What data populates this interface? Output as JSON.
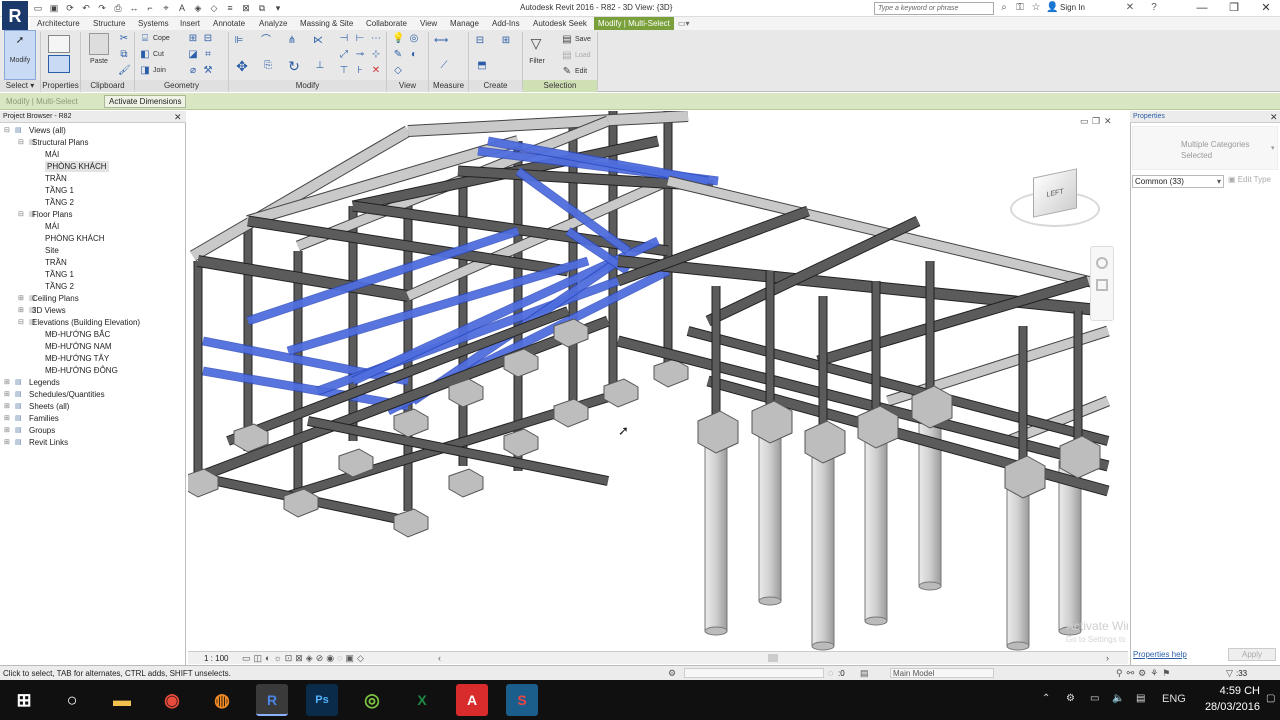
{
  "app": {
    "logo": "R",
    "title": "Autodesk Revit 2016 -    R82 - 3D View: {3D}",
    "search_placeholder": "Type a keyword or phrase",
    "sign_in": "Sign In"
  },
  "tabs": [
    "Architecture",
    "Structure",
    "Systems",
    "Insert",
    "Annotate",
    "Analyze",
    "Massing & Site",
    "Collaborate",
    "View",
    "Manage",
    "Add-Ins",
    "Autodesk Seek",
    "Modify | Multi-Select"
  ],
  "ribbon": {
    "modify": "Modify",
    "paste": "Paste",
    "cope": "Cope",
    "cut": "Cut",
    "join": "Join",
    "filter": "Filter",
    "save": "Save",
    "load": "Load",
    "edit": "Edit",
    "panels": [
      "Select",
      "Properties",
      "Clipboard",
      "Geometry",
      "Modify",
      "View",
      "Measure",
      "Create",
      "Selection"
    ]
  },
  "options_bar": {
    "context": "Modify | Multi-Select",
    "activate": "Activate Dimensions"
  },
  "project_browser": {
    "title": "Project Browser - R82",
    "items": [
      {
        "label": "Views (all)",
        "level": 0,
        "selected": false
      },
      {
        "label": "Structural Plans",
        "level": 1,
        "selected": false
      },
      {
        "label": "MÁI",
        "level": 2,
        "selected": false
      },
      {
        "label": "PHÒNG KHÁCH",
        "level": 2,
        "selected": true
      },
      {
        "label": "TRẦN",
        "level": 2,
        "selected": false
      },
      {
        "label": "TẦNG 1",
        "level": 2,
        "selected": false
      },
      {
        "label": "TẦNG 2",
        "level": 2,
        "selected": false
      },
      {
        "label": "Floor Plans",
        "level": 1,
        "selected": false
      },
      {
        "label": "MÁI",
        "level": 2,
        "selected": false
      },
      {
        "label": "PHÒNG KHÁCH",
        "level": 2,
        "selected": false
      },
      {
        "label": "Site",
        "level": 2,
        "selected": false
      },
      {
        "label": "TRẦN",
        "level": 2,
        "selected": false
      },
      {
        "label": "TẦNG 1",
        "level": 2,
        "selected": false
      },
      {
        "label": "TẦNG 2",
        "level": 2,
        "selected": false
      },
      {
        "label": "Ceiling Plans",
        "level": 1,
        "selected": false
      },
      {
        "label": "3D Views",
        "level": 1,
        "selected": false
      },
      {
        "label": "Elevations (Building Elevation)",
        "level": 1,
        "selected": false
      },
      {
        "label": "MĐ-HƯỚNG BẮC",
        "level": 2,
        "selected": false
      },
      {
        "label": "MĐ-HƯỚNG NAM",
        "level": 2,
        "selected": false
      },
      {
        "label": "MĐ-HƯỚNG TÂY",
        "level": 2,
        "selected": false
      },
      {
        "label": "MĐ-HƯỚNG ĐÔNG",
        "level": 2,
        "selected": false
      },
      {
        "label": "Legends",
        "level": 0,
        "selected": false
      },
      {
        "label": "Schedules/Quantities",
        "level": 0,
        "selected": false
      },
      {
        "label": "Sheets (all)",
        "level": 0,
        "selected": false
      },
      {
        "label": "Families",
        "level": 0,
        "selected": false
      },
      {
        "label": "Groups",
        "level": 0,
        "selected": false
      },
      {
        "label": "Revit Links",
        "level": 0,
        "selected": false
      }
    ]
  },
  "view": {
    "viewcube_face": "LEFT",
    "scale": "1 : 100"
  },
  "properties": {
    "title": "Properties",
    "type_line1": "Multiple Categories",
    "type_line2": "Selected",
    "filter": "Common (33)",
    "edit_type": "Edit Type",
    "help": "Properties help",
    "apply": "Apply"
  },
  "watermark": {
    "line1": "Activate Windows",
    "line2": "Go to Settings to activate Windows."
  },
  "status": {
    "hint": "Click to select, TAB for alternates, CTRL adds, SHIFT unselects.",
    "coord": ":0",
    "model": "Main Model",
    "count": ":33"
  },
  "taskbar": {
    "language": "ENG",
    "time": "4:59 CH",
    "date": "28/03/2016"
  }
}
